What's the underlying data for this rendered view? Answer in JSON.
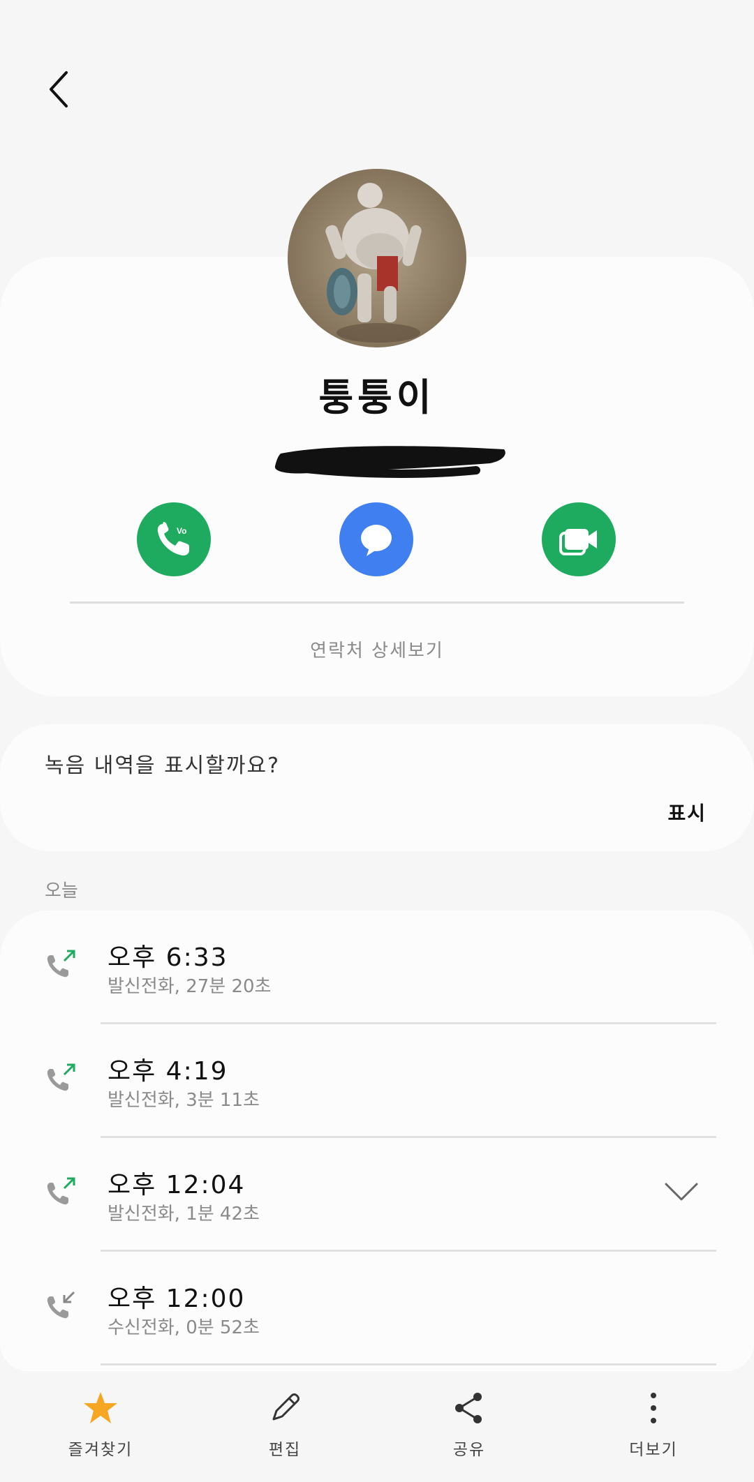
{
  "header": {
    "back_icon": "chevron-left-icon"
  },
  "contact": {
    "name": "퉁퉁이",
    "details_link": "연락처 상세보기",
    "actions": [
      {
        "name": "call",
        "icon": "phone-volte-icon",
        "color": "#1eab60"
      },
      {
        "name": "message",
        "icon": "chat-bubble-icon",
        "color": "#3f7ff0"
      },
      {
        "name": "video",
        "icon": "video-camera-icon",
        "color": "#1eab60"
      }
    ]
  },
  "recording": {
    "question": "녹음 내역을 표시할까요?",
    "show_label": "표시"
  },
  "log": {
    "section_label": "오늘",
    "entries": [
      {
        "time": "오후 6:33",
        "detail": "발신전화, 27분 20초",
        "direction": "outgoing"
      },
      {
        "time": "오후 4:19",
        "detail": "발신전화, 3분 11초",
        "direction": "outgoing"
      },
      {
        "time": "오후 12:04",
        "detail": "발신전화, 1분 42초",
        "direction": "outgoing",
        "expandable": true
      },
      {
        "time": "오후 12:00",
        "detail": "수신전화, 0분 52초",
        "direction": "incoming"
      }
    ]
  },
  "bottom_nav": {
    "favorite": "즐겨찾기",
    "edit": "편집",
    "share": "공유",
    "more": "더보기"
  },
  "colors": {
    "accent_green": "#1eab60",
    "accent_blue": "#3f7ff0",
    "star": "#f5a623",
    "outgoing_arrow": "#1eab60",
    "incoming_arrow": "#888888"
  }
}
